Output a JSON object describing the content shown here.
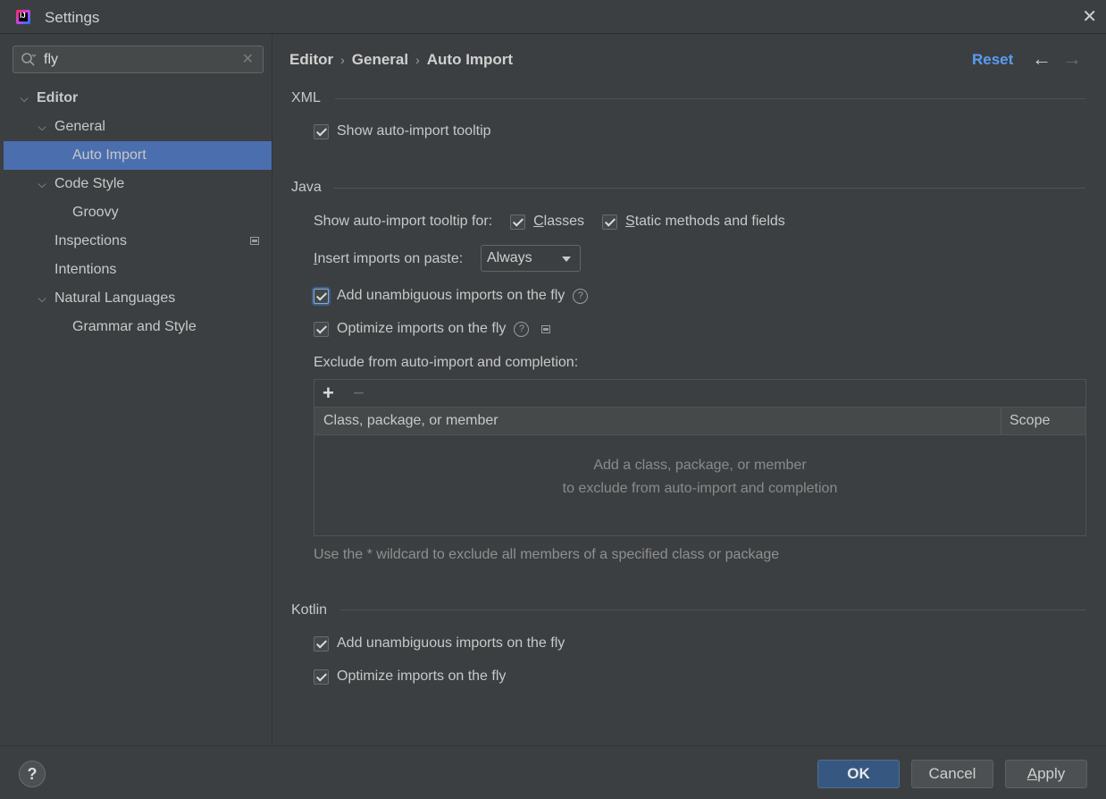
{
  "window": {
    "title": "Settings",
    "close_icon": "close-icon"
  },
  "search": {
    "value": "fly",
    "placeholder": ""
  },
  "tree": {
    "editor": "Editor",
    "general": "General",
    "auto_import": "Auto Import",
    "code_style": "Code Style",
    "groovy": "Groovy",
    "inspections": "Inspections",
    "intentions": "Intentions",
    "natural_languages": "Natural Languages",
    "grammar_and_style": "Grammar and Style"
  },
  "breadcrumb": {
    "items": [
      "Editor",
      "General",
      "Auto Import"
    ],
    "sep": "›"
  },
  "header": {
    "reset": "Reset",
    "back_arrow": "←",
    "forward_arrow": "→"
  },
  "xml": {
    "title": "XML",
    "show_tooltip": "Show auto-import tooltip"
  },
  "java": {
    "title": "Java",
    "tooltip_for_label": "Show auto-import tooltip for:",
    "classes_first": "C",
    "classes_rest": "lasses",
    "static_first": "S",
    "static_rest": "tatic methods and fields",
    "insert_paste_first": "I",
    "insert_paste_rest": "nsert imports on paste:",
    "insert_paste_value": "Always",
    "add_unambiguous": "Add unambiguous imports on the fly",
    "optimize": "Optimize imports on the fly",
    "exclude_label": "Exclude from auto-import and completion:",
    "table": {
      "add": "+",
      "remove": "−",
      "col_member": "Class, package, or member",
      "col_scope": "Scope",
      "empty_line1": "Add a class, package, or member",
      "empty_line2": "to exclude from auto-import and completion"
    },
    "hint": "Use the * wildcard to exclude all members of a specified class or package"
  },
  "kotlin": {
    "title": "Kotlin",
    "add_unambiguous": "Add unambiguous imports on the fly",
    "optimize": "Optimize imports on the fly"
  },
  "footer": {
    "help": "?",
    "ok": "OK",
    "cancel": "Cancel",
    "apply_first": "A",
    "apply_rest": "pply"
  },
  "colors": {
    "background": "#3c3f41",
    "selection": "#4b6eaf",
    "link": "#589df6",
    "ok_button": "#365880"
  }
}
